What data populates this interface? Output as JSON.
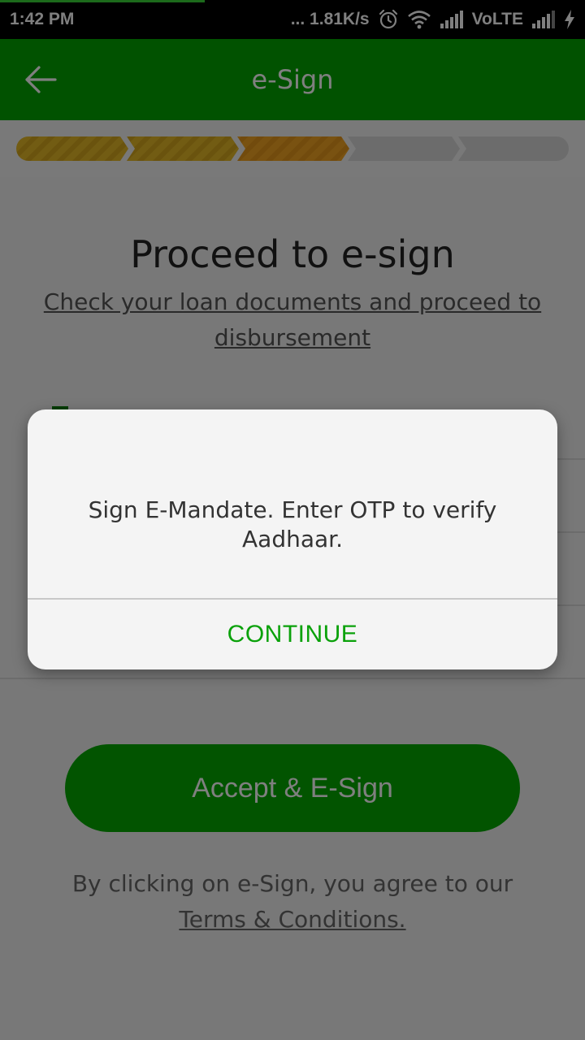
{
  "status_bar": {
    "time": "1:42 PM",
    "net_speed": "... 1.81K/s",
    "network": "VoLTE",
    "icons": [
      "alarm-icon",
      "wifi-icon",
      "signal-icon",
      "signal-icon",
      "charging-icon"
    ]
  },
  "app_bar": {
    "title": "e-Sign",
    "back_icon": "back-arrow-icon"
  },
  "progress": {
    "total_steps": 5,
    "completed_steps": 3
  },
  "content": {
    "heading": "Proceed to e-sign",
    "subheading": "Check your loan documents and proceed to disbursement",
    "accept_button": "Accept & E-Sign",
    "agree_text": "By clicking on e-Sign, you agree to our",
    "terms_link": "Terms & Conditions."
  },
  "dialog": {
    "message": "Sign E-Mandate. Enter OTP to verify Aadhaar.",
    "button": "CONTINUE"
  },
  "colors": {
    "brand_green": "#03a400",
    "progress_yellow": "#e3b726",
    "progress_orange": "#f0a020",
    "progress_gray": "#d5d5d5",
    "dialog_button": "#0aa10a"
  }
}
